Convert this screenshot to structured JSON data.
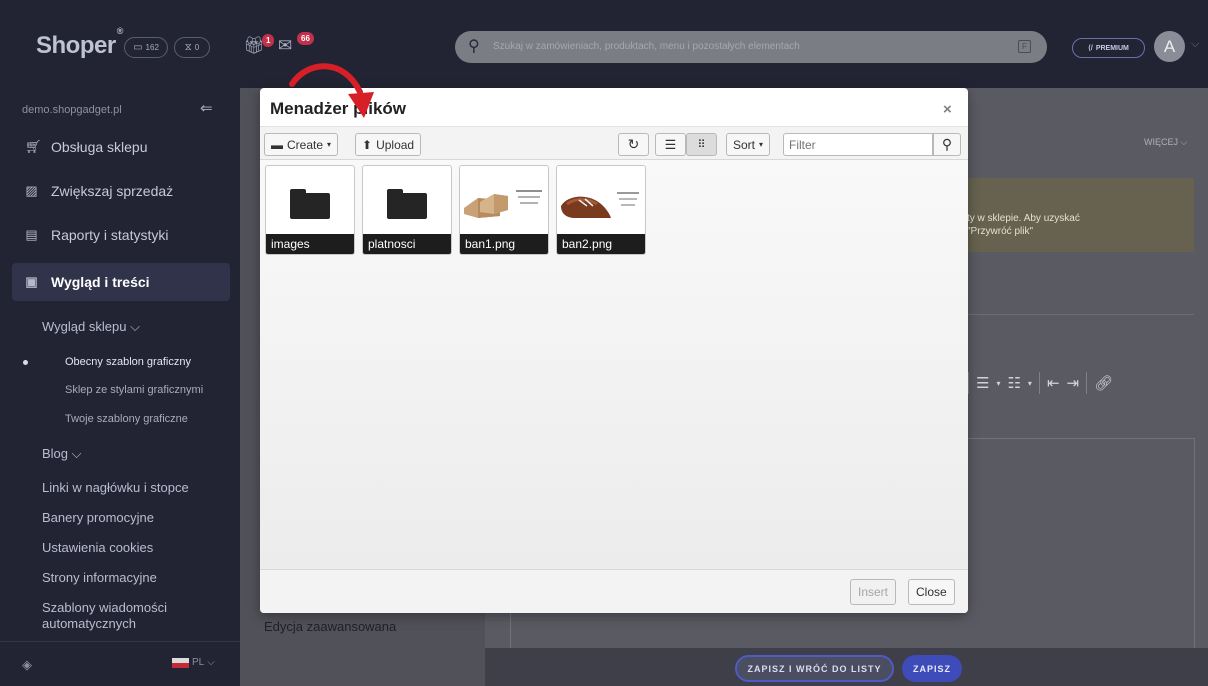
{
  "topbar": {
    "logo": "Shoper",
    "logo_mark": "®",
    "orders_count": "162",
    "waiting_count": "0",
    "gift_badge": "1",
    "mail_badge": "66",
    "search_placeholder": "Szukaj w zamówieniach, produktach, menu i pozostałych elementach",
    "search_kbd": "F",
    "premium": "PREMIUM",
    "avatar_letter": "A"
  },
  "sidebar": {
    "domain": "demo.shopgadget.pl",
    "items": [
      {
        "label": "Obsługa sklepu",
        "icon": "cart-icon"
      },
      {
        "label": "Zwiększaj sprzedaż",
        "icon": "chart-icon"
      },
      {
        "label": "Raporty i statystyki",
        "icon": "clipboard-icon"
      },
      {
        "label": "Wygląd i treści",
        "icon": "image-icon"
      }
    ],
    "sub_wyglad": "Wygląd sklepu",
    "sub_items": [
      "Obecny szablon graficzny",
      "Sklep ze stylami graficznymi",
      "Twoje szablony graficzne"
    ],
    "blog": "Blog",
    "links": [
      "Linki w nagłówku i stopce",
      "Banery promocyjne",
      "Ustawienia cookies",
      "Strony informacyjne"
    ],
    "templates_line1": "Szablony wiadomości",
    "templates_line2": "automatycznych",
    "lang": "PL"
  },
  "background": {
    "wiecej": "WIĘCEJ",
    "warning_line1": "ty w sklepie. Aby uzyskać",
    "warning_line2": "\"Przywróć plik\"",
    "edycja": "Edycja zaawansowana",
    "save_back": "ZAPISZ I WRÓĆ DO LISTY",
    "save": "ZAPISZ"
  },
  "file_manager": {
    "title": "Menadżer plików",
    "close_glyph": "×",
    "create": "Create",
    "upload": "Upload",
    "sort": "Sort",
    "filter_placeholder": "Filter",
    "files": [
      {
        "name": "images",
        "kind": "folder"
      },
      {
        "name": "platnosci",
        "kind": "folder"
      },
      {
        "name": "ban1.png",
        "kind": "image"
      },
      {
        "name": "ban2.png",
        "kind": "image"
      }
    ],
    "insert": "Insert",
    "close": "Close"
  },
  "colors": {
    "annotation_arrow": "#d61f26",
    "accent": "#3d4cb8"
  }
}
